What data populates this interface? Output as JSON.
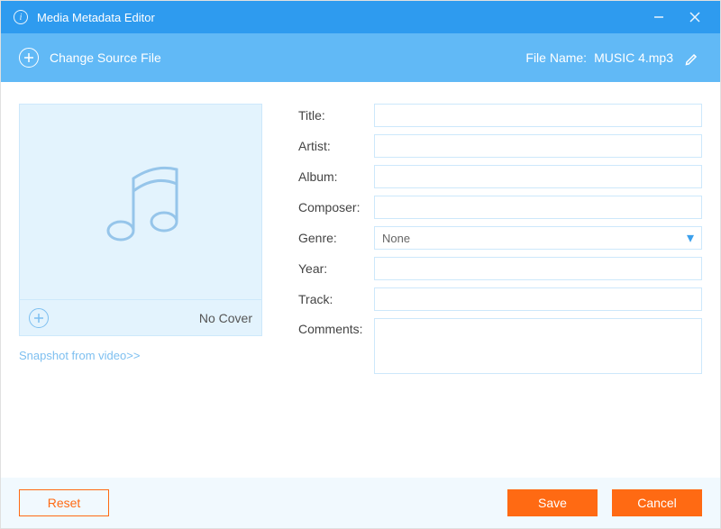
{
  "titlebar": {
    "title": "Media Metadata Editor"
  },
  "toolbar": {
    "change_source_label": "Change Source File",
    "file_name_label": "File Name:",
    "file_name_value": "MUSIC 4.mp3"
  },
  "cover": {
    "no_cover_label": "No Cover",
    "snapshot_link": "Snapshot from video>>"
  },
  "form": {
    "title": {
      "label": "Title:",
      "value": ""
    },
    "artist": {
      "label": "Artist:",
      "value": ""
    },
    "album": {
      "label": "Album:",
      "value": ""
    },
    "composer": {
      "label": "Composer:",
      "value": ""
    },
    "genre": {
      "label": "Genre:",
      "selected": "None"
    },
    "year": {
      "label": "Year:",
      "value": ""
    },
    "track": {
      "label": "Track:",
      "value": ""
    },
    "comments": {
      "label": "Comments:",
      "value": ""
    }
  },
  "footer": {
    "reset": "Reset",
    "save": "Save",
    "cancel": "Cancel"
  },
  "colors": {
    "primary": "#2E9BEF",
    "primary_light": "#61B9F6",
    "accent": "#FF6A13",
    "panel_soft": "#E3F3FD",
    "border_soft": "#cde8fb"
  }
}
